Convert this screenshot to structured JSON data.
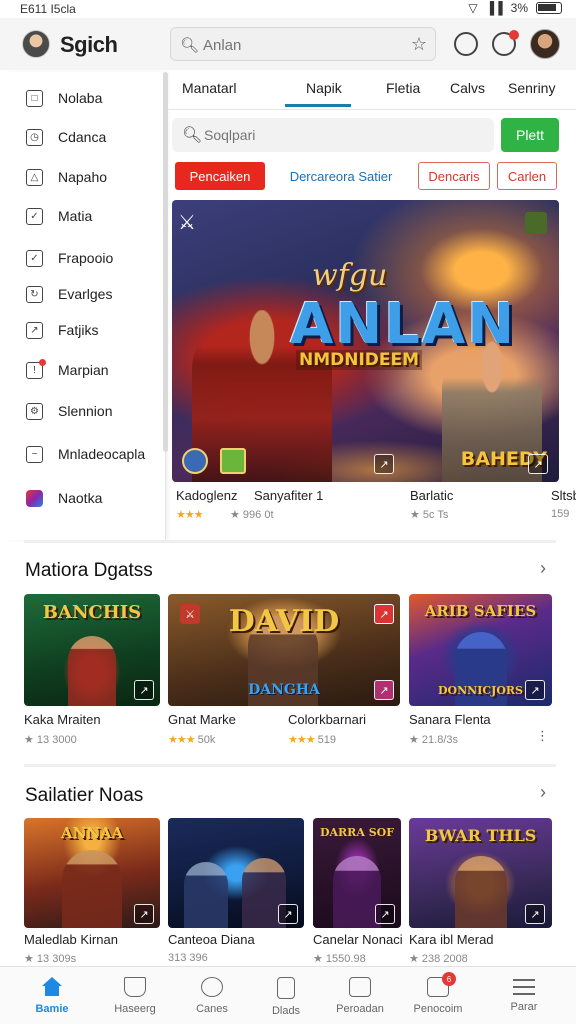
{
  "status_bar": {
    "time": "E611 I5cla",
    "battery": "3%"
  },
  "header": {
    "app_title": "Sgich",
    "search_placeholder": "Anlan"
  },
  "drawer": {
    "items": [
      {
        "label": "Nolaba",
        "icon": "square-icon"
      },
      {
        "label": "Cdanca",
        "icon": "clock-icon"
      },
      {
        "label": "Napaho",
        "icon": "triangle-icon"
      },
      {
        "label": "Matia",
        "icon": "check-icon"
      },
      {
        "label": "Frapooio",
        "icon": "check-icon"
      },
      {
        "label": "Evarlges",
        "icon": "refresh-icon"
      },
      {
        "label": "Fatjiks",
        "icon": "edit-icon"
      },
      {
        "label": "Marpian",
        "icon": "alert-icon"
      },
      {
        "label": "Slennion",
        "icon": "settings-icon"
      },
      {
        "label": "Mnladeocapla",
        "icon": "minus-icon"
      },
      {
        "label": "Naotka",
        "icon": "app-icon"
      }
    ]
  },
  "tabs": [
    "Manatarl",
    "Napik",
    "Fletia",
    "Calvs",
    "Senriny"
  ],
  "active_tab": "Napik",
  "search2": {
    "placeholder": "Soqlpari",
    "button": "Plett"
  },
  "chips": [
    "Pencaiken",
    "Dercareora Satier",
    "Dencaris",
    "Carlen"
  ],
  "hero": {
    "title_top": "wfgu",
    "title": "ANLAN",
    "subtitle": "NMDNIDEEM",
    "badge": "BAHEDY"
  },
  "hero_cards": [
    {
      "title": "Kadoglenz",
      "rating_text": "",
      "stars": 3
    },
    {
      "title": "Sanyafiter 1",
      "rating_text": "996 0t",
      "stars": 0
    },
    {
      "title": "Barlatic",
      "rating_text": "5c Ts",
      "stars": 1
    },
    {
      "title": "Sltsb",
      "rating_text": "159",
      "stars": 0
    }
  ],
  "section1": {
    "title": "Matiora Dgatss",
    "games": [
      {
        "title": "Kaka Mraiten",
        "rating_text": "13 3000",
        "stars": 1,
        "art_text": "BANCHIS"
      },
      {
        "title": "Gnat Marke",
        "rating_text": "50k",
        "stars": 3,
        "art_text": "DAVID"
      },
      {
        "title": "Colorkbarnari",
        "rating_text": "519",
        "stars": 3,
        "art_text": ""
      },
      {
        "title": "Sanara Flenta",
        "rating_text": "21.8/3s",
        "stars": 1,
        "art_text": "ARIB SAFIES"
      }
    ]
  },
  "section2": {
    "title": "Sailatier Noas",
    "games": [
      {
        "title": "Maledlab Kirnan",
        "rating_text": "13 309s",
        "stars": 0,
        "art_text": "ANNAA"
      },
      {
        "title": "Canteoa Diana",
        "rating_text": "313 396",
        "stars": 0,
        "art_text": ""
      },
      {
        "title": "Canelar Nonaci",
        "rating_text": "1550.98",
        "stars": 0,
        "art_text": "DARRA SOF"
      },
      {
        "title": "Kara ibl Merad",
        "rating_text": "238 2008",
        "stars": 0,
        "art_text": "BWAR THLS"
      }
    ]
  },
  "bottom_nav": [
    {
      "label": "Bamie",
      "icon": "home-icon",
      "active": true
    },
    {
      "label": "Haseerg",
      "icon": "shop-icon"
    },
    {
      "label": "Canes",
      "icon": "search-circle-icon"
    },
    {
      "label": "Dlads",
      "icon": "card-icon"
    },
    {
      "label": "Peroadan",
      "icon": "chat-icon"
    },
    {
      "label": "Penocoim",
      "icon": "notification-icon",
      "badge": "6"
    },
    {
      "label": "Parar",
      "icon": "menu-icon"
    }
  ],
  "colors": {
    "accent": "#1e88e5",
    "red": "#e8281e",
    "green": "#2fb344",
    "tab_underline": "#1a7fa8"
  }
}
